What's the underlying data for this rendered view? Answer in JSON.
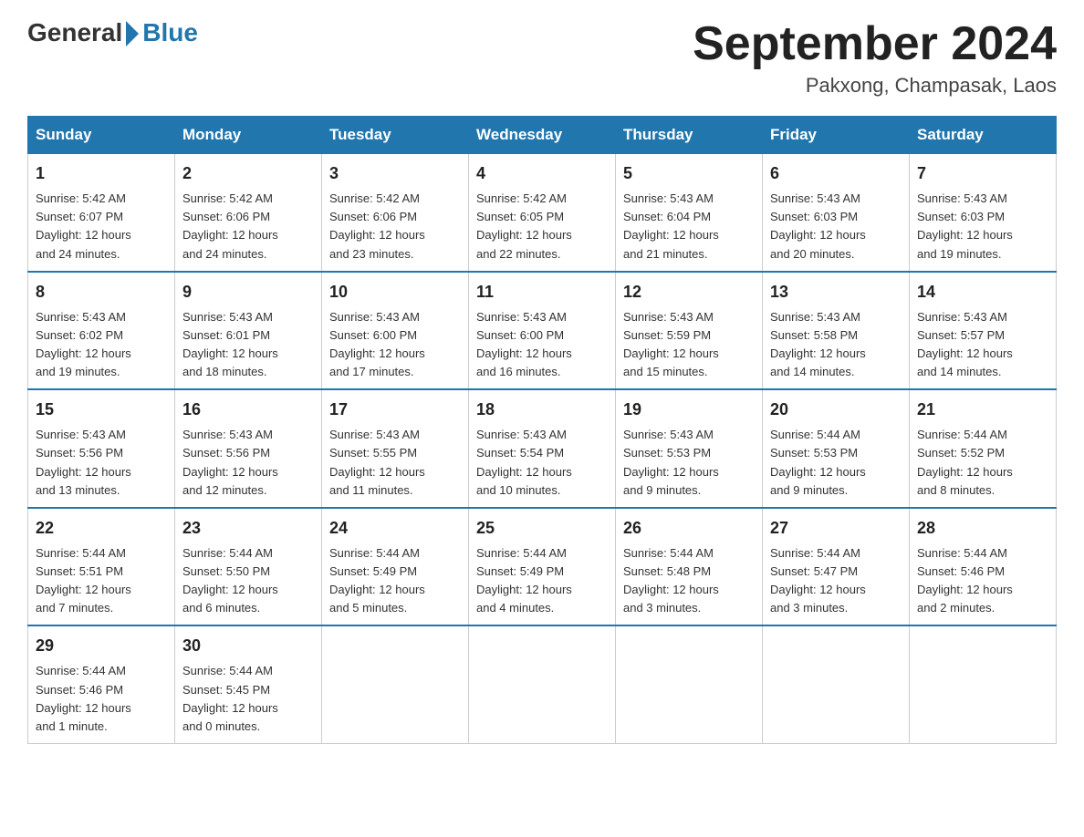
{
  "header": {
    "logo_general": "General",
    "logo_blue": "Blue",
    "month_title": "September 2024",
    "location": "Pakxong, Champasak, Laos"
  },
  "days_of_week": [
    "Sunday",
    "Monday",
    "Tuesday",
    "Wednesday",
    "Thursday",
    "Friday",
    "Saturday"
  ],
  "weeks": [
    [
      {
        "day": "1",
        "sunrise": "5:42 AM",
        "sunset": "6:07 PM",
        "daylight": "12 hours and 24 minutes."
      },
      {
        "day": "2",
        "sunrise": "5:42 AM",
        "sunset": "6:06 PM",
        "daylight": "12 hours and 24 minutes."
      },
      {
        "day": "3",
        "sunrise": "5:42 AM",
        "sunset": "6:06 PM",
        "daylight": "12 hours and 23 minutes."
      },
      {
        "day": "4",
        "sunrise": "5:42 AM",
        "sunset": "6:05 PM",
        "daylight": "12 hours and 22 minutes."
      },
      {
        "day": "5",
        "sunrise": "5:43 AM",
        "sunset": "6:04 PM",
        "daylight": "12 hours and 21 minutes."
      },
      {
        "day": "6",
        "sunrise": "5:43 AM",
        "sunset": "6:03 PM",
        "daylight": "12 hours and 20 minutes."
      },
      {
        "day": "7",
        "sunrise": "5:43 AM",
        "sunset": "6:03 PM",
        "daylight": "12 hours and 19 minutes."
      }
    ],
    [
      {
        "day": "8",
        "sunrise": "5:43 AM",
        "sunset": "6:02 PM",
        "daylight": "12 hours and 19 minutes."
      },
      {
        "day": "9",
        "sunrise": "5:43 AM",
        "sunset": "6:01 PM",
        "daylight": "12 hours and 18 minutes."
      },
      {
        "day": "10",
        "sunrise": "5:43 AM",
        "sunset": "6:00 PM",
        "daylight": "12 hours and 17 minutes."
      },
      {
        "day": "11",
        "sunrise": "5:43 AM",
        "sunset": "6:00 PM",
        "daylight": "12 hours and 16 minutes."
      },
      {
        "day": "12",
        "sunrise": "5:43 AM",
        "sunset": "5:59 PM",
        "daylight": "12 hours and 15 minutes."
      },
      {
        "day": "13",
        "sunrise": "5:43 AM",
        "sunset": "5:58 PM",
        "daylight": "12 hours and 14 minutes."
      },
      {
        "day": "14",
        "sunrise": "5:43 AM",
        "sunset": "5:57 PM",
        "daylight": "12 hours and 14 minutes."
      }
    ],
    [
      {
        "day": "15",
        "sunrise": "5:43 AM",
        "sunset": "5:56 PM",
        "daylight": "12 hours and 13 minutes."
      },
      {
        "day": "16",
        "sunrise": "5:43 AM",
        "sunset": "5:56 PM",
        "daylight": "12 hours and 12 minutes."
      },
      {
        "day": "17",
        "sunrise": "5:43 AM",
        "sunset": "5:55 PM",
        "daylight": "12 hours and 11 minutes."
      },
      {
        "day": "18",
        "sunrise": "5:43 AM",
        "sunset": "5:54 PM",
        "daylight": "12 hours and 10 minutes."
      },
      {
        "day": "19",
        "sunrise": "5:43 AM",
        "sunset": "5:53 PM",
        "daylight": "12 hours and 9 minutes."
      },
      {
        "day": "20",
        "sunrise": "5:44 AM",
        "sunset": "5:53 PM",
        "daylight": "12 hours and 9 minutes."
      },
      {
        "day": "21",
        "sunrise": "5:44 AM",
        "sunset": "5:52 PM",
        "daylight": "12 hours and 8 minutes."
      }
    ],
    [
      {
        "day": "22",
        "sunrise": "5:44 AM",
        "sunset": "5:51 PM",
        "daylight": "12 hours and 7 minutes."
      },
      {
        "day": "23",
        "sunrise": "5:44 AM",
        "sunset": "5:50 PM",
        "daylight": "12 hours and 6 minutes."
      },
      {
        "day": "24",
        "sunrise": "5:44 AM",
        "sunset": "5:49 PM",
        "daylight": "12 hours and 5 minutes."
      },
      {
        "day": "25",
        "sunrise": "5:44 AM",
        "sunset": "5:49 PM",
        "daylight": "12 hours and 4 minutes."
      },
      {
        "day": "26",
        "sunrise": "5:44 AM",
        "sunset": "5:48 PM",
        "daylight": "12 hours and 3 minutes."
      },
      {
        "day": "27",
        "sunrise": "5:44 AM",
        "sunset": "5:47 PM",
        "daylight": "12 hours and 3 minutes."
      },
      {
        "day": "28",
        "sunrise": "5:44 AM",
        "sunset": "5:46 PM",
        "daylight": "12 hours and 2 minutes."
      }
    ],
    [
      {
        "day": "29",
        "sunrise": "5:44 AM",
        "sunset": "5:46 PM",
        "daylight": "12 hours and 1 minute."
      },
      {
        "day": "30",
        "sunrise": "5:44 AM",
        "sunset": "5:45 PM",
        "daylight": "12 hours and 0 minutes."
      },
      null,
      null,
      null,
      null,
      null
    ]
  ],
  "labels": {
    "sunrise_prefix": "Sunrise: ",
    "sunset_prefix": "Sunset: ",
    "daylight_prefix": "Daylight: "
  }
}
